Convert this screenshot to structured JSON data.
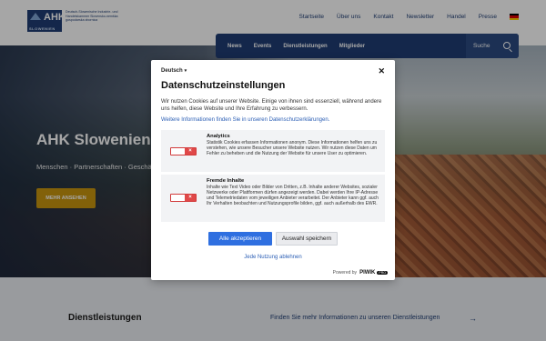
{
  "header": {
    "logo_text": "AHK",
    "logo_sub": "SLOWENIEN",
    "logo_tagline": "Deutsch-Slowenische Industrie- und Handelskammer Slovensko-nemška gospodarska zbornica",
    "nav": [
      "Startseite",
      "Über uns",
      "Kontakt",
      "Newsletter",
      "Handel",
      "Presse"
    ]
  },
  "mainnav": {
    "items": [
      "News",
      "Events",
      "Dienstleistungen",
      "Mitglieder"
    ],
    "search_label": "Suche"
  },
  "hero": {
    "title": "AHK Slowenien",
    "subtitle": "Menschen · Partnerschaften · Geschäft",
    "button": "MEHR ANSEHEN"
  },
  "bottom": {
    "title": "Dienstleistungen",
    "link": "Finden Sie mehr Informationen zu unseren Dienstleistungen"
  },
  "modal": {
    "language": "Deutsch",
    "title": "Datenschutzeinstellungen",
    "description": "Wir nutzen Cookies auf unserer Website. Einige von ihnen sind essenziell, während andere uns helfen, diese Website und Ihre Erfahrung zu verbessern.",
    "link": "Weitere Informationen finden Sie in unseren Datenschutzerklärungen.",
    "categories": [
      {
        "title": "Analytics",
        "text": "Statistik Cookies erfassen Informationen anonym. Diese Informationen helfen uns zu verstehen, wie unsere Besucher unsere Website nutzen. Wir nutzen diese Daten um Fehler zu beheben und die Nutzung der Website für unsere User zu optimieren."
      },
      {
        "title": "Fremde Inhalte",
        "text": "Inhalte wie Text Video oder Bilder von Dritten, z.B. Inhalte anderer Websites, sozialer Netzwerke oder Plattformen dürfen angezeigt werden. Dabei werden Ihre IP-Adresse und Telemetriedaten vom jeweiligen Anbieter verarbeitet. Der Anbieter kann ggf. auch Ihr Verhalten beobachten und Nutzungsprofile bilden, ggf. auch außerhalb des EWR."
      }
    ],
    "accept_all": "Alle akzeptieren",
    "save_selection": "Auswahl speichern",
    "reject": "Jede Nutzung ablehnen",
    "powered_by": "Powered by",
    "brand": "PIWIK",
    "brand_badge": "PRO"
  },
  "colors": {
    "brand": "#1f3d73",
    "accent": "#c8960f",
    "primary_button": "#2f6fe0",
    "toggle_off": "#e04848"
  }
}
